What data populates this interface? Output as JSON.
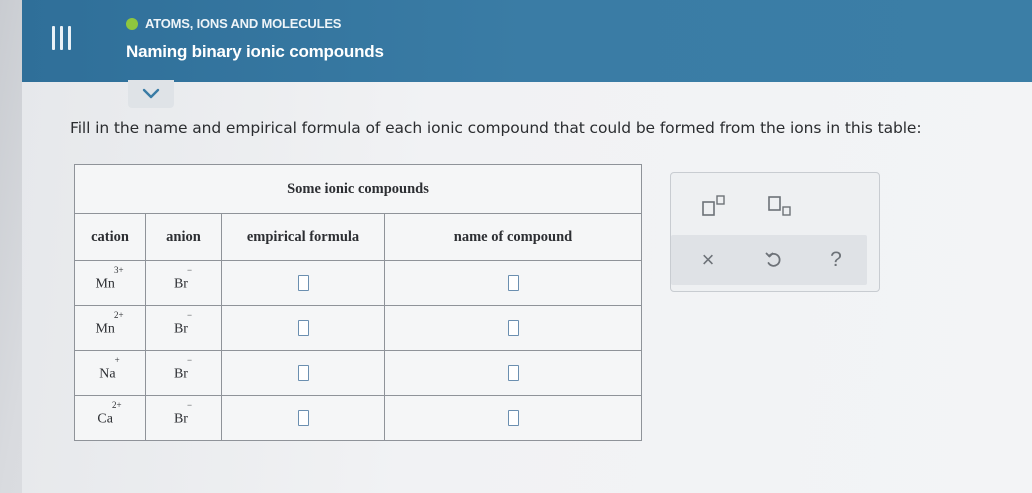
{
  "header": {
    "breadcrumb": "ATOMS, IONS AND MOLECULES",
    "title": "Naming binary ionic compounds",
    "accent_color": "#3a7ca5",
    "status_dot_color": "#8ec63f",
    "menu_icon": "hamburger-menu-icon",
    "collapse_icon": "chevron-down-icon"
  },
  "instruction": "Fill in the name and empirical formula of each ionic compound that could be formed from the ions in this table:",
  "table": {
    "caption": "Some ionic compounds",
    "columns": [
      "cation",
      "anion",
      "empirical formula",
      "name of compound"
    ],
    "rows": [
      {
        "cation": "Mn",
        "cation_charge": "3+",
        "anion": "Br",
        "anion_charge": "−"
      },
      {
        "cation": "Mn",
        "cation_charge": "2+",
        "anion": "Br",
        "anion_charge": "−"
      },
      {
        "cation": "Na",
        "cation_charge": "+",
        "anion": "Br",
        "anion_charge": "−"
      },
      {
        "cation": "Ca",
        "cation_charge": "2+",
        "anion": "Br",
        "anion_charge": "−"
      }
    ]
  },
  "tools": {
    "superscript_icon": "superscript-box-icon",
    "subscript_icon": "subscript-box-icon",
    "clear": "×",
    "undo_icon": "undo-icon",
    "help": "?"
  }
}
